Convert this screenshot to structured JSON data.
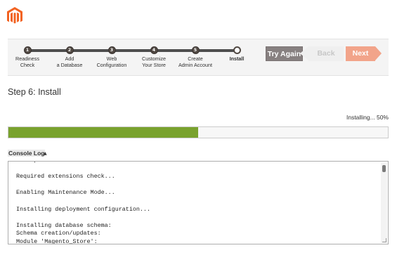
{
  "brand": {
    "logo_icon": "magento-logo-icon",
    "color": "#f26322"
  },
  "wizard": {
    "steps": [
      {
        "number": "1",
        "label_line1": "Readiness",
        "label_line2": "Check",
        "state": "done"
      },
      {
        "number": "2",
        "label_line1": "Add",
        "label_line2": "a Database",
        "state": "done"
      },
      {
        "number": "3",
        "label_line1": "Web",
        "label_line2": "Configuration",
        "state": "done"
      },
      {
        "number": "4",
        "label_line1": "Customize",
        "label_line2": "Your Store",
        "state": "done"
      },
      {
        "number": "5",
        "label_line1": "Create",
        "label_line2": "Admin Account",
        "state": "done"
      },
      {
        "number": "",
        "label_line1": "Install",
        "label_line2": "",
        "state": "current"
      }
    ],
    "buttons": {
      "try_again": "Try Again",
      "back": "Back",
      "next": "Next"
    }
  },
  "main": {
    "title": "Step 6: Install",
    "progress": {
      "text": "Installing... 50%",
      "percent": 50,
      "color": "#79a22e"
    },
    "console": {
      "title": "Console Log",
      "caret_icon": "caret-up-icon",
      "lines": [
        "File permissions check...",
        "",
        "Required extensions check...",
        "",
        "Enabling Maintenance Mode...",
        "",
        "Installing deployment configuration...",
        "",
        "Installing database schema:",
        "Schema creation/updates:",
        "Module 'Magento_Store':"
      ]
    }
  }
}
